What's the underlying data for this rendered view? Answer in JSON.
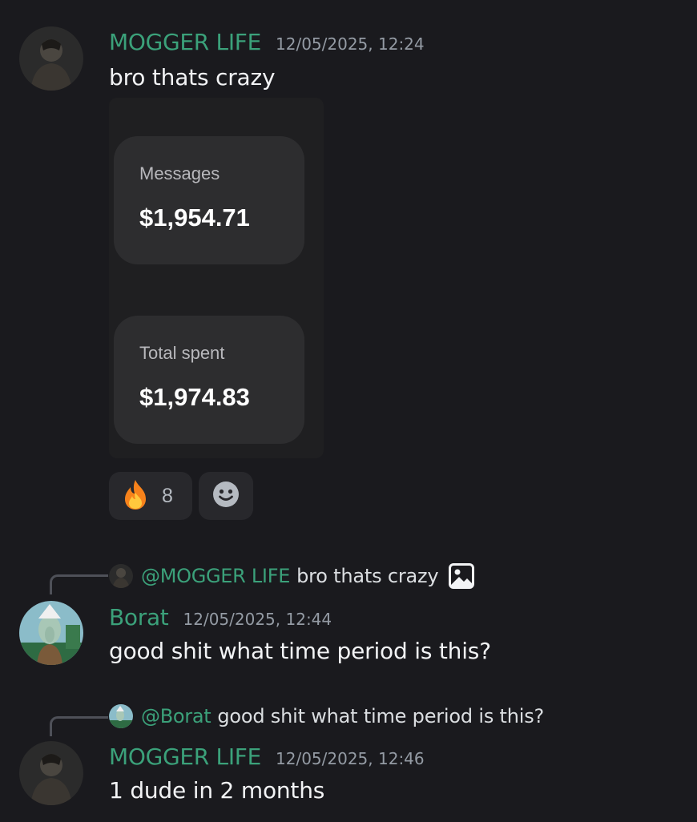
{
  "messages": [
    {
      "username": "MOGGER LIFE",
      "timestamp": "12/05/2025, 12:24",
      "text": "bro thats crazy",
      "attachment": {
        "cards": [
          {
            "label": "Messages",
            "value": "$1,954.71"
          },
          {
            "label": "Total spent",
            "value": "$1,974.83"
          }
        ]
      },
      "reactions": [
        {
          "icon": "fire-emoji",
          "count": "8"
        },
        {
          "icon": "add-reaction-icon"
        }
      ]
    },
    {
      "reply": {
        "mention": "@MOGGER LIFE",
        "text": "bro thats crazy",
        "icon": "image-icon"
      },
      "username": "Borat",
      "timestamp": "12/05/2025, 12:44",
      "text": "good shit what time period is this?"
    },
    {
      "reply": {
        "mention": "@Borat",
        "text": "good shit what time period is this?"
      },
      "username": "MOGGER LIFE",
      "timestamp": "12/05/2025, 12:46",
      "text": "1 dude in 2 months"
    }
  ],
  "colors": {
    "background": "#1a1a1e",
    "username": "#3ba17a",
    "timestamp": "#949ba4",
    "text": "#f2f3f5"
  }
}
